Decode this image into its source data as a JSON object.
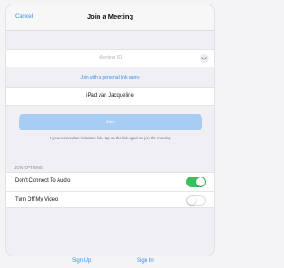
{
  "nav": {
    "cancel_label": "Cancel",
    "title": "Join a Meeting"
  },
  "meeting_id": {
    "placeholder": "Meeting ID",
    "dropdown_icon": "chevron-down-icon"
  },
  "personal_link_label": "Join with a personal link name",
  "name_field": {
    "value": "iPad van Jacqueline"
  },
  "join_button_label": "Join",
  "hint_text": "If you received an invitation link, tap on the link again to join the meeting",
  "join_options": {
    "section_title": "JOIN OPTIONS",
    "items": [
      {
        "label": "Don't Connect To Audio",
        "state": "on"
      },
      {
        "label": "Turn Off My Video",
        "state": "off"
      }
    ]
  },
  "footer": {
    "sign_up_label": "Sign Up",
    "sign_in_label": "Sign In"
  },
  "colors": {
    "accent": "#3a8cf0",
    "join_disabled": "#a8cdf5",
    "toggle_on": "#3ac15a"
  }
}
